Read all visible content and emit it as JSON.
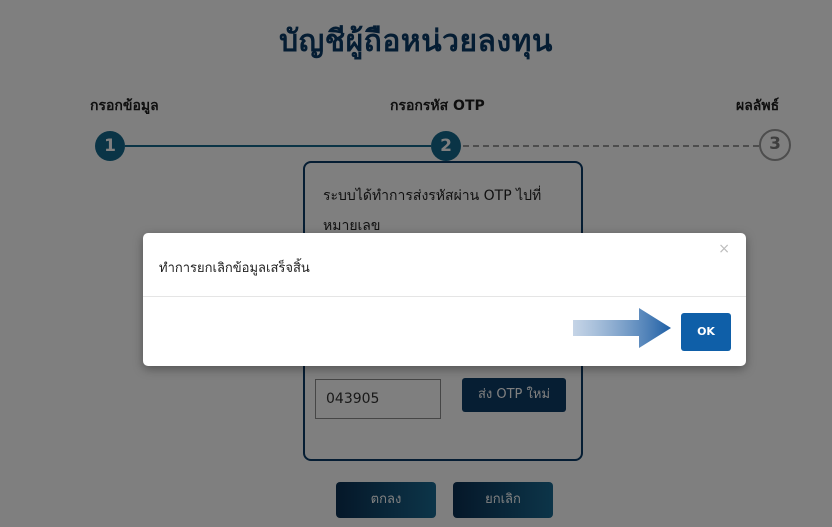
{
  "page": {
    "title": "บัญชีผู้ถือหน่วยลงทุน",
    "steps": [
      {
        "label": "กรอกข้อมูล",
        "number": "1",
        "state": "done"
      },
      {
        "label": "กรอกรหัส OTP",
        "number": "2",
        "state": "current"
      },
      {
        "label": "ผลลัพธ์",
        "number": "3",
        "state": "pending"
      }
    ],
    "otp_message": "ระบบได้ทำการส่งรหัสผ่าน OTP ไปที่หมายเลข",
    "otp_value": "043905",
    "resend_label": "ส่ง OTP ใหม่",
    "confirm_label": "ตกลง",
    "cancel_label": "ยกเลิก"
  },
  "modal": {
    "message": "ทำการยกเลิกข้อมูลเสร็จสิ้น",
    "close_glyph": "×",
    "ok_label": "OK"
  },
  "colors": {
    "brand_dark": "#0b3a66",
    "step_active": "#15698d",
    "modal_ok": "#0f5fa8",
    "arrow": "#1e5fa5"
  },
  "icons": {
    "close": "close-icon",
    "pointer_arrow": "arrow-right-icon"
  }
}
